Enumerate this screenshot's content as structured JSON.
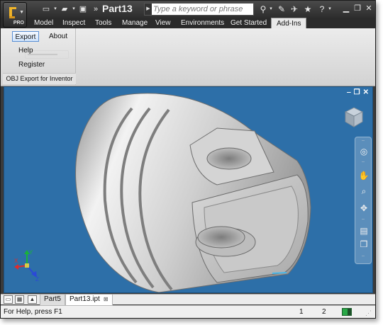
{
  "window": {
    "doc_title": "Part13",
    "app_badge": "PRO",
    "search_placeholder": "Type a keyword or phrase"
  },
  "ribbon": {
    "tabs": [
      {
        "label": "Model"
      },
      {
        "label": "Inspect"
      },
      {
        "label": "Tools"
      },
      {
        "label": "Manage"
      },
      {
        "label": "View"
      },
      {
        "label": "Environments"
      },
      {
        "label": "Get Started"
      },
      {
        "label": "Add-Ins",
        "active": true
      }
    ],
    "panel": {
      "buttons": [
        "Export",
        "About",
        "Help",
        "Register"
      ],
      "label": "OBJ Export for Inventor"
    }
  },
  "viewport": {
    "background": "#2d6fa8",
    "nav_icons": [
      "steering-wheel-icon",
      "pan-icon",
      "zoom-icon",
      "orbit-icon",
      "look-at-icon",
      "view-cube-icon"
    ],
    "triad_labels": {
      "x": "X",
      "y": "Y",
      "z": "Z"
    }
  },
  "doc_tabs": {
    "tabs": [
      {
        "label": "Part5"
      },
      {
        "label": "Part13.ipt",
        "active": true
      }
    ]
  },
  "status": {
    "help_text": "For Help, press F1",
    "count_1": "1",
    "count_2": "2",
    "indicator_color": "#28a746"
  }
}
